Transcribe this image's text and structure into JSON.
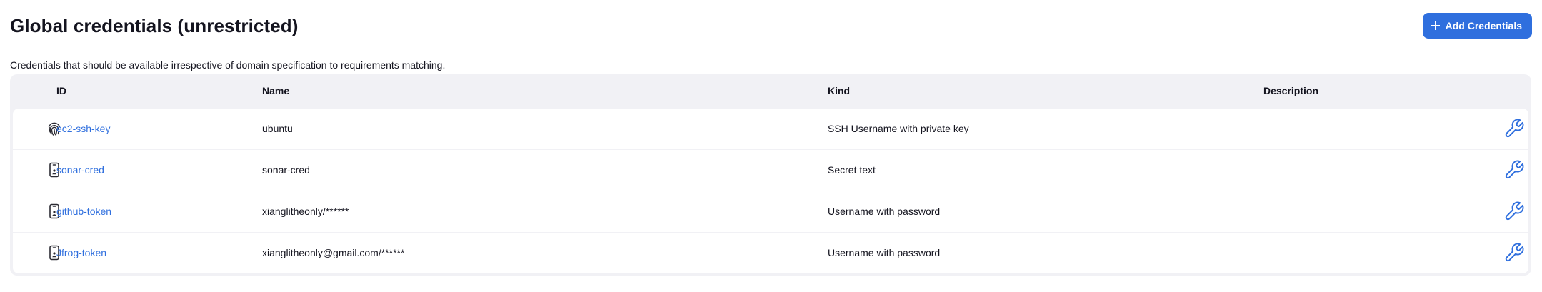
{
  "header": {
    "title": "Global credentials (unrestricted)",
    "add_button_label": "Add Credentials"
  },
  "subtitle": "Credentials that should be available irrespective of domain specification to requirements matching.",
  "table": {
    "columns": [
      "ID",
      "Name",
      "Kind",
      "Description"
    ],
    "rows": [
      {
        "icon": "fingerprint-icon",
        "id": "ec2-ssh-key",
        "name": "ubuntu",
        "kind": "SSH Username with private key",
        "description": ""
      },
      {
        "icon": "mobile-device-icon",
        "id": "sonar-cred",
        "name": "sonar-cred",
        "kind": "Secret text",
        "description": ""
      },
      {
        "icon": "mobile-device-icon",
        "id": "github-token",
        "name": "xianglitheonly/******",
        "kind": "Username with password",
        "description": ""
      },
      {
        "icon": "mobile-device-icon",
        "id": "Jfrog-token",
        "name": "xianglitheonly@gmail.com/******",
        "kind": "Username with password",
        "description": ""
      }
    ]
  },
  "colors": {
    "accent": "#2f6fde",
    "table_background": "#f1f1f5",
    "text": "#14141f"
  }
}
